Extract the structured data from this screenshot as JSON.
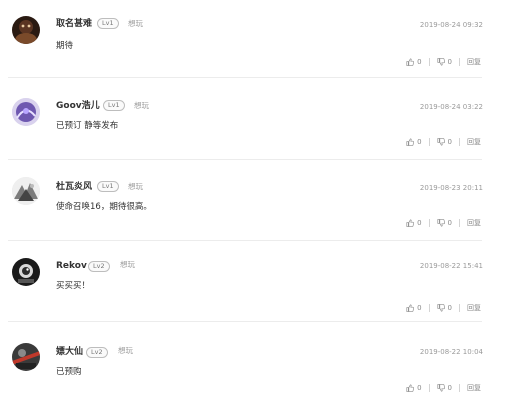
{
  "comments": [
    {
      "user": "取名甚难",
      "level": "Lv1",
      "status": "想玩",
      "time": "2019-08-24 09:32",
      "text": "期待",
      "likes": "0",
      "dislikes": "0",
      "reply_label": "回复",
      "avatar_color": "#3a2418"
    },
    {
      "user": "Goov浩儿",
      "level": "Lv1",
      "status": "想玩",
      "time": "2019-08-24 03:22",
      "text": "已预订 静等发布",
      "likes": "0",
      "dislikes": "0",
      "reply_label": "回复",
      "avatar_color": "#5b4b8a"
    },
    {
      "user": "杜瓦炎风",
      "level": "Lv1",
      "status": "想玩",
      "time": "2019-08-23 20:11",
      "text": "使命召唤16，期待很高。",
      "likes": "0",
      "dislikes": "0",
      "reply_label": "回复",
      "avatar_color": "#8c8c8c"
    },
    {
      "user": "Rekov",
      "level": "Lv2",
      "status": "想玩",
      "time": "2019-08-22 15:41",
      "text": "买买买！",
      "likes": "0",
      "dislikes": "0",
      "reply_label": "回复",
      "avatar_color": "#222222"
    },
    {
      "user": "嫖大仙",
      "level": "Lv2",
      "status": "想玩",
      "time": "2019-08-22 10:04",
      "text": "已预购",
      "likes": "0",
      "dislikes": "0",
      "reply_label": "回复",
      "avatar_color": "#4a4a4a"
    }
  ]
}
